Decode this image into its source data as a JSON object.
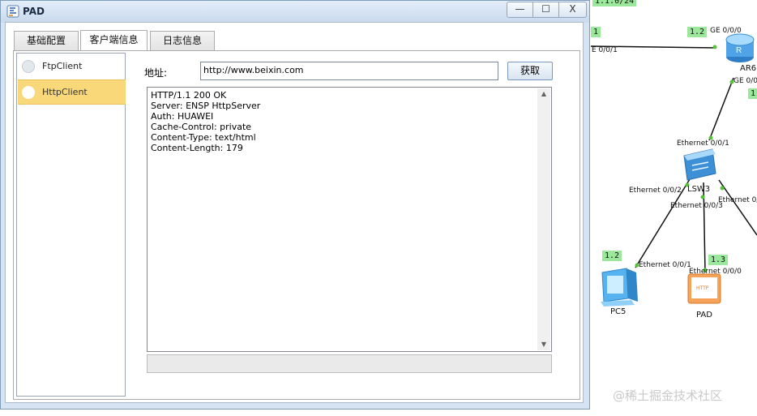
{
  "window": {
    "title": "PAD",
    "controls": {
      "minimize": "—",
      "maximize": "☐",
      "close": "X"
    }
  },
  "tabs": [
    {
      "label": "基础配置",
      "active": false
    },
    {
      "label": "客户端信息",
      "active": true
    },
    {
      "label": "日志信息",
      "active": false
    }
  ],
  "sidebar": {
    "items": [
      {
        "label": "FtpClient",
        "selected": false
      },
      {
        "label": "HttpClient",
        "selected": true
      }
    ]
  },
  "address": {
    "label": "地址:",
    "value": "http://www.beixin.com"
  },
  "get_button": "获取",
  "response": {
    "lines": [
      "HTTP/1.1 200 OK",
      "Server: ENSP HttpServer",
      "Auth: HUAWEI",
      "Cache-Control: private",
      "Content-Type: text/html",
      "Content-Length: 179"
    ]
  },
  "topology": {
    "net_labels": {
      "top": "1.1.0/24",
      "left": "1",
      "ar_ip": "1.2",
      "right_edge": "1",
      "pc_ip": "1.2",
      "pad_ip": "1.3"
    },
    "ports": {
      "ar_ge0": "GE 0/0/0",
      "left_port": "E 0/0/1",
      "ar_ge1": "GE 0/0",
      "sw_e1": "Ethernet 0/0/1",
      "sw_e2": "Ethernet 0/0/2",
      "sw_e3": "Ethernet 0/0/3",
      "sw_e_right": "Ethernet 0/",
      "pc_e1": "Ethernet 0/0/1",
      "pad_e0": "Ethernet 0/0/0"
    },
    "devices": {
      "router": "AR6",
      "switch": "LSW3",
      "pc": "PC5",
      "pad": "PAD",
      "pad_screen": "HTTP"
    },
    "link_color": "#111111",
    "port_dot_color": "#56c23a"
  },
  "watermark": "@稀土掘金技术社区"
}
